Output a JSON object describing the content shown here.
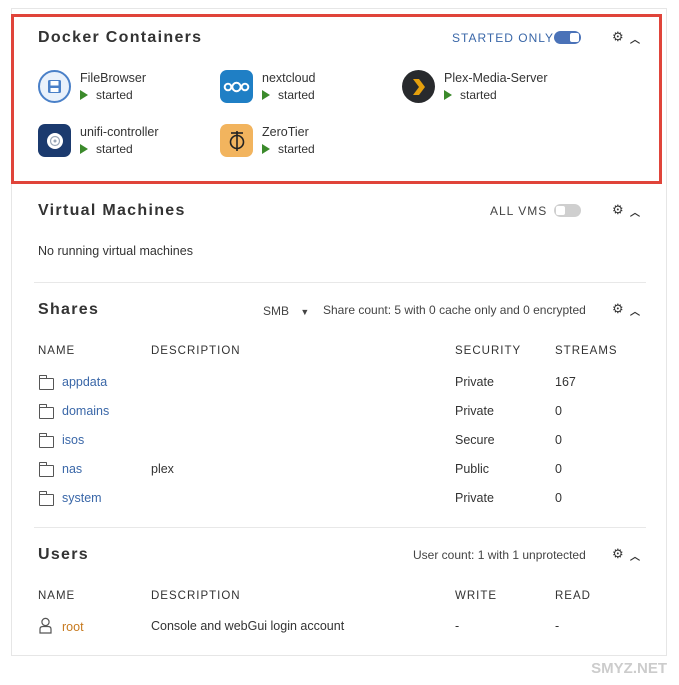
{
  "docker": {
    "title": "Docker Containers",
    "filter_label": "STARTED ONLY",
    "containers": [
      {
        "name": "FileBrowser",
        "status": "started"
      },
      {
        "name": "nextcloud",
        "status": "started"
      },
      {
        "name": "Plex-Media-Server",
        "status": "started"
      },
      {
        "name": "unifi-controller",
        "status": "started"
      },
      {
        "name": "ZeroTier",
        "status": "started"
      }
    ]
  },
  "vms": {
    "title": "Virtual Machines",
    "filter_label": "ALL VMS",
    "empty_text": "No running virtual machines"
  },
  "shares": {
    "title": "Shares",
    "protocol": "SMB",
    "summary": "Share count: 5 with 0 cache only and 0 encrypted",
    "columns": [
      "NAME",
      "DESCRIPTION",
      "SECURITY",
      "STREAMS"
    ],
    "rows": [
      {
        "name": "appdata",
        "description": "",
        "security": "Private",
        "streams": "167"
      },
      {
        "name": "domains",
        "description": "",
        "security": "Private",
        "streams": "0"
      },
      {
        "name": "isos",
        "description": "",
        "security": "Secure",
        "streams": "0"
      },
      {
        "name": "nas",
        "description": "plex",
        "security": "Public",
        "streams": "0"
      },
      {
        "name": "system",
        "description": "",
        "security": "Private",
        "streams": "0"
      }
    ]
  },
  "users": {
    "title": "Users",
    "summary": "User count: 1 with 1 unprotected",
    "columns": [
      "NAME",
      "DESCRIPTION",
      "WRITE",
      "READ"
    ],
    "rows": [
      {
        "name": "root",
        "description": "Console and webGui login account",
        "write": "-",
        "read": "-"
      }
    ]
  },
  "watermark": "SMYZ.NET",
  "colors": {
    "highlight_border": "#e0443a",
    "link": "#3a67a8",
    "status_green": "#3b8a2b",
    "toggle_on": "#4a72b8"
  }
}
